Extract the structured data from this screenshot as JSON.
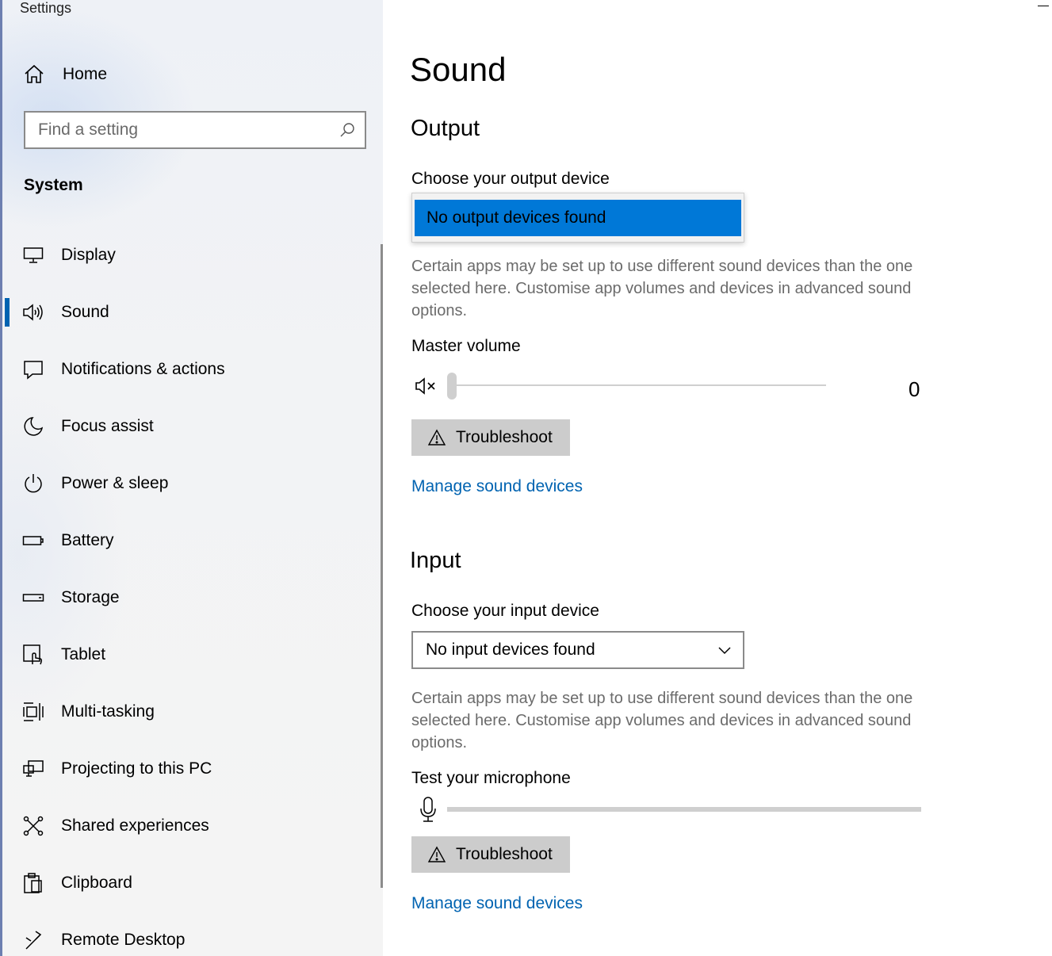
{
  "window": {
    "app_title": "Settings"
  },
  "sidebar": {
    "home_label": "Home",
    "search_placeholder": "Find a setting",
    "section_label": "System",
    "items": [
      {
        "label": "Display",
        "icon": "monitor-icon"
      },
      {
        "label": "Sound",
        "icon": "speaker-icon",
        "active": true
      },
      {
        "label": "Notifications & actions",
        "icon": "notification-icon"
      },
      {
        "label": "Focus assist",
        "icon": "moon-icon"
      },
      {
        "label": "Power & sleep",
        "icon": "power-icon"
      },
      {
        "label": "Battery",
        "icon": "battery-icon"
      },
      {
        "label": "Storage",
        "icon": "storage-icon"
      },
      {
        "label": "Tablet",
        "icon": "tablet-icon"
      },
      {
        "label": "Multi-tasking",
        "icon": "multitasking-icon"
      },
      {
        "label": "Projecting to this PC",
        "icon": "projecting-icon"
      },
      {
        "label": "Shared experiences",
        "icon": "shared-experiences-icon"
      },
      {
        "label": "Clipboard",
        "icon": "clipboard-icon"
      },
      {
        "label": "Remote Desktop",
        "icon": "remote-desktop-icon"
      }
    ]
  },
  "main": {
    "title": "Sound",
    "output": {
      "heading": "Output",
      "choose_label": "Choose your output device",
      "dropdown_option": "No output devices found",
      "description": "Certain apps may be set up to use different sound devices than the one selected here. Customise app volumes and devices in advanced sound options.",
      "volume_label": "Master volume",
      "volume_value": "0",
      "troubleshoot_label": "Troubleshoot",
      "manage_link": "Manage sound devices"
    },
    "input": {
      "heading": "Input",
      "choose_label": "Choose your input device",
      "dropdown_value": "No input devices found",
      "description": "Certain apps may be set up to use different sound devices than the one selected here. Customise app volumes and devices in advanced sound options.",
      "test_label": "Test your microphone",
      "troubleshoot_label": "Troubleshoot",
      "manage_link": "Manage sound devices"
    }
  },
  "colors": {
    "accent": "#0078d7",
    "link": "#0063b1",
    "active_indicator": "#0063b1"
  }
}
